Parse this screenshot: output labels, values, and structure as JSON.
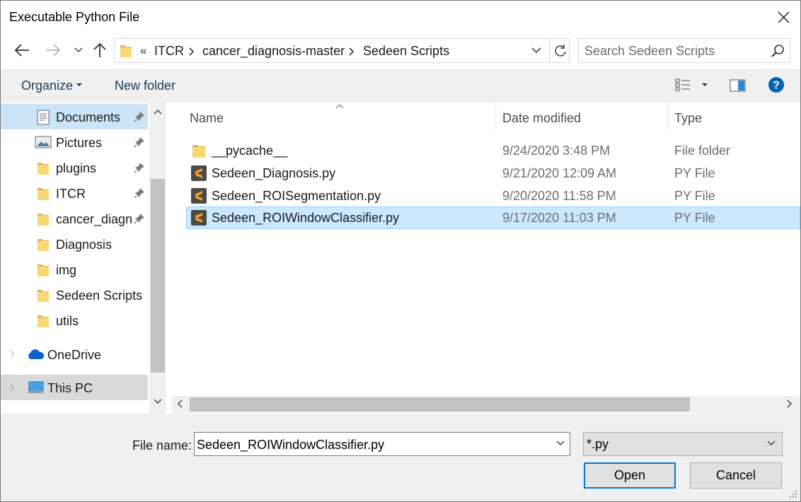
{
  "window": {
    "title": "Executable Python File"
  },
  "address": {
    "overflow": "«",
    "crumbs": [
      "ITCR",
      "cancer_diagnosis-master",
      "Sedeen Scripts"
    ],
    "search_placeholder": "Search Sedeen Scripts"
  },
  "toolbar": {
    "organize": "Organize",
    "new_folder": "New folder"
  },
  "nav": {
    "items": [
      {
        "label": "Documents",
        "icon": "documents-icon",
        "pinned": true
      },
      {
        "label": "Pictures",
        "icon": "pictures-icon",
        "pinned": true
      },
      {
        "label": "plugins",
        "icon": "folder-icon",
        "pinned": true
      },
      {
        "label": "ITCR",
        "icon": "folder-icon",
        "pinned": true
      },
      {
        "label": "cancer_diagnc",
        "icon": "folder-icon",
        "pinned": true
      },
      {
        "label": "Diagnosis",
        "icon": "folder-icon",
        "pinned": false
      },
      {
        "label": "img",
        "icon": "folder-icon",
        "pinned": false
      },
      {
        "label": "Sedeen Scripts",
        "icon": "folder-icon",
        "pinned": false
      },
      {
        "label": "utils",
        "icon": "folder-icon",
        "pinned": false
      }
    ],
    "onedrive": "OneDrive",
    "thispc": "This PC"
  },
  "columns": {
    "name": "Name",
    "date": "Date modified",
    "type": "Type"
  },
  "files": [
    {
      "name": "__pycache__",
      "date": "9/24/2020 3:48 PM",
      "type": "File folder",
      "icon": "folder-icon"
    },
    {
      "name": "Sedeen_Diagnosis.py",
      "date": "9/21/2020 12:09 AM",
      "type": "PY File",
      "icon": "sublime-file-icon"
    },
    {
      "name": "Sedeen_ROISegmentation.py",
      "date": "9/20/2020 11:58 PM",
      "type": "PY File",
      "icon": "sublime-file-icon"
    },
    {
      "name": "Sedeen_ROIWindowClassifier.py",
      "date": "9/17/2020 11:03 PM",
      "type": "PY File",
      "icon": "sublime-file-icon",
      "selected": true
    }
  ],
  "bottom": {
    "file_name_label": "File name:",
    "file_name_value": "Sedeen_ROIWindowClassifier.py",
    "file_type": "*.py",
    "open": "Open",
    "cancel": "Cancel"
  },
  "colors": {
    "accent": "#0078d7",
    "selection": "#cce8ff",
    "nav_selection": "#cce4f7",
    "sublime_orange": "#f79a1e"
  }
}
